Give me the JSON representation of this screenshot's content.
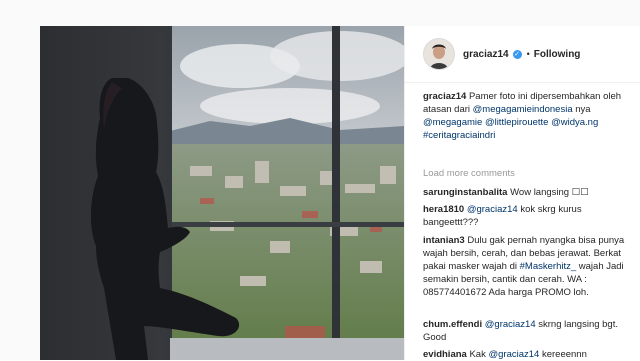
{
  "post": {
    "username": "graciaz14",
    "verified": true,
    "separator": "•",
    "follow_label": "Following"
  },
  "caption": {
    "username": "graciaz14",
    "text_1": "Pamer foto ini dipersembahkan oleh atasan dari",
    "mention_1": "@megagamieindonesia",
    "text_2": "nya",
    "mention_2": "@megagamie",
    "mention_3": "@littlepirouette",
    "mention_4": "@widya.ng",
    "hashtag": "#ceritagraciaindri"
  },
  "load_more_label": "Load more comments",
  "comments": [
    {
      "user": "sarunginstanbalita",
      "text": "Wow langsing ☐☐"
    },
    {
      "user": "hera1810",
      "mention": "@graciaz14",
      "text": "kok skrg kurus bangeettt???"
    },
    {
      "user": "intanian3",
      "text_1": "Dulu gak pernah nyangka bisa punya wajah bersih, cerah, dan bebas jerawat. Berkat pakai masker wajah di",
      "hashtag": "#Maskerhitz_",
      "text_2": "wajah Jadi semakin bersih, cantik dan cerah. WA : 085774401672 Ada harga PROMO loh."
    },
    {
      "user": "chum.effendi",
      "mention": "@graciaz14",
      "text": "skrng langsing bgt. Good"
    },
    {
      "user": "evidhiana",
      "text_1": "Kak",
      "mention": "@graciaz14",
      "text_2": "kereeennn"
    }
  ],
  "colors": {
    "link": "#003569",
    "verified": "#3897f0",
    "muted": "#999999"
  }
}
